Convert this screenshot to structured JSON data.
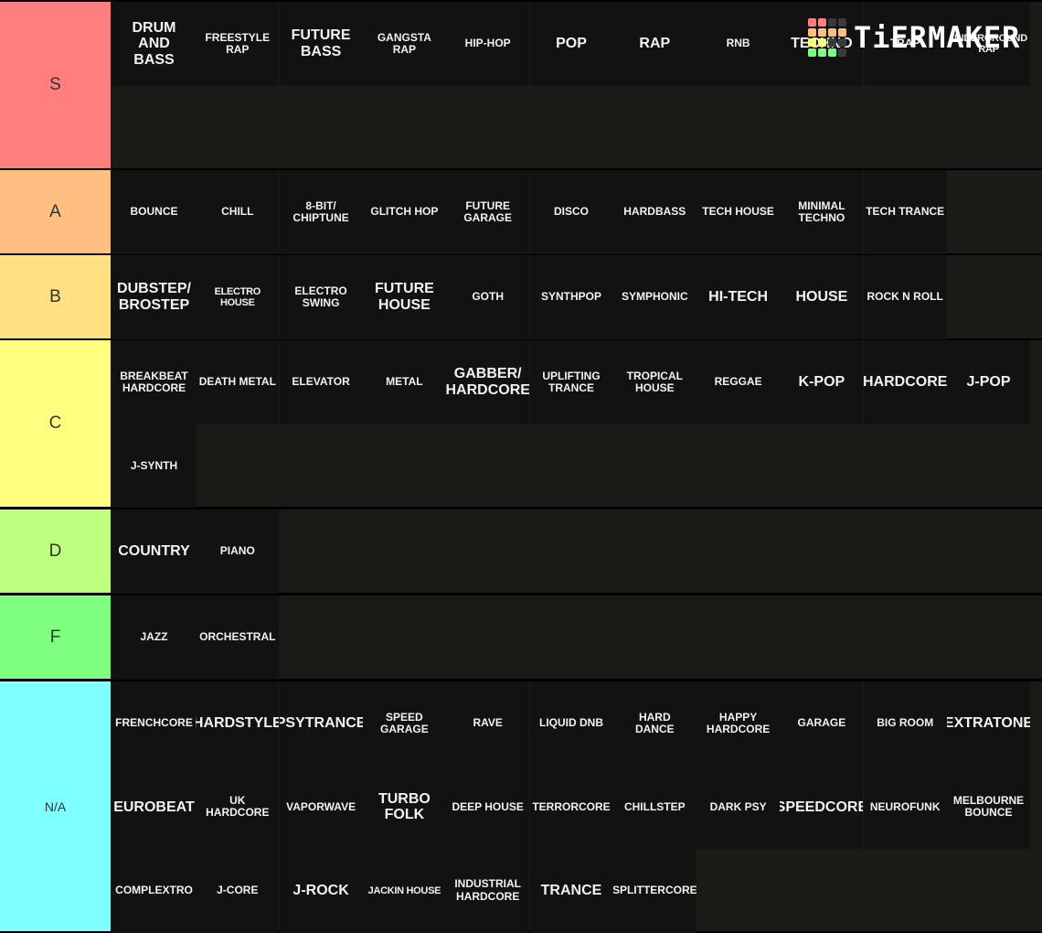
{
  "logo": {
    "text": "TiERMAKER",
    "grid_colors": [
      "#ff7f7f",
      "#ff7f7f",
      "#3a3a3a",
      "#3a3a3a",
      "#ffbf7f",
      "#ffbf7f",
      "#ffbf7f",
      "#ffbf7f",
      "#ffff7f",
      "#ffff7f",
      "#3a3a3a",
      "#3a3a3a",
      "#7fff7f",
      "#7fff7f",
      "#7fff7f",
      "#3a3a3a"
    ]
  },
  "tiers": [
    {
      "label": "S",
      "color": "#ff7f7f",
      "items": [
        {
          "text": "DRUM\nAND\nBASS",
          "size": "l"
        },
        {
          "text": "FREESTYLE\nRAP",
          "size": "s"
        },
        {
          "text": "FUTURE\nBASS",
          "size": "l"
        },
        {
          "text": "GANGSTA\nRAP",
          "size": "s"
        },
        {
          "text": "HIP-HOP",
          "size": "s"
        },
        {
          "text": "POP",
          "size": "l"
        },
        {
          "text": "RAP",
          "size": "l"
        },
        {
          "text": "RNB",
          "size": "s"
        },
        {
          "text": "TECHNO",
          "size": "l"
        },
        {
          "text": "TRAP",
          "size": "s"
        },
        {
          "text": "UNDERGROUND\nRAP",
          "size": "xs"
        }
      ]
    },
    {
      "label": "A",
      "color": "#ffbf7f",
      "items": [
        {
          "text": "BOUNCE",
          "size": "s"
        },
        {
          "text": "CHILL",
          "size": "s"
        },
        {
          "text": "8-BIT/\nCHIPTUNE",
          "size": "s"
        },
        {
          "text": "GLITCH HOP",
          "size": "s"
        },
        {
          "text": "FUTURE\nGARAGE",
          "size": "s"
        },
        {
          "text": "DISCO",
          "size": "s"
        },
        {
          "text": "HARDBASS",
          "size": "s"
        },
        {
          "text": "TECH HOUSE",
          "size": "s"
        },
        {
          "text": "MINIMAL\nTECHNO",
          "size": "s"
        },
        {
          "text": "TECH TRANCE",
          "size": "s"
        }
      ]
    },
    {
      "label": "B",
      "color": "#ffdf7f",
      "items": [
        {
          "text": "DUBSTEP/\nBROSTEP",
          "size": "l"
        },
        {
          "text": "ELECTRO HOUSE",
          "size": "xs"
        },
        {
          "text": "ELECTRO\nSWING",
          "size": "s"
        },
        {
          "text": "FUTURE\nHOUSE",
          "size": "l"
        },
        {
          "text": "GOTH",
          "size": "s"
        },
        {
          "text": "SYNTHPOP",
          "size": "s"
        },
        {
          "text": "SYMPHONIC",
          "size": "s"
        },
        {
          "text": "HI-TECH",
          "size": "l"
        },
        {
          "text": "HOUSE",
          "size": "l"
        },
        {
          "text": "ROCK N ROLL",
          "size": "s"
        }
      ]
    },
    {
      "label": "C",
      "color": "#ffff7f",
      "items": [
        {
          "text": "BREAKBEAT\nHARDCORE",
          "size": "s"
        },
        {
          "text": "DEATH METAL",
          "size": "s"
        },
        {
          "text": "ELEVATOR",
          "size": "s"
        },
        {
          "text": "METAL",
          "size": "s"
        },
        {
          "text": "GABBER/\nHARDCORE",
          "size": "l"
        },
        {
          "text": "UPLIFTING\nTRANCE",
          "size": "s"
        },
        {
          "text": "TROPICAL\nHOUSE",
          "size": "s"
        },
        {
          "text": "REGGAE",
          "size": "s"
        },
        {
          "text": "K-POP",
          "size": "l"
        },
        {
          "text": "HARDCORE",
          "size": "l"
        },
        {
          "text": "J-POP",
          "size": "l"
        },
        {
          "text": "J-SYNTH",
          "size": "s"
        }
      ]
    },
    {
      "label": "D",
      "color": "#bfff7f",
      "items": [
        {
          "text": "COUNTRY",
          "size": "l"
        },
        {
          "text": "PIANO",
          "size": "s"
        }
      ]
    },
    {
      "label": "F",
      "color": "#7fff7f",
      "items": [
        {
          "text": "JAZZ",
          "size": "s"
        },
        {
          "text": "ORCHESTRAL",
          "size": "s"
        }
      ]
    },
    {
      "label": "N/A",
      "color": "#7fffff",
      "items": [
        {
          "text": "FRENCHCORE",
          "size": "s"
        },
        {
          "text": "HARDSTYLE",
          "size": "l"
        },
        {
          "text": "PSYTRANCE",
          "size": "l"
        },
        {
          "text": "SPEED\nGARAGE",
          "size": "s"
        },
        {
          "text": "RAVE",
          "size": "s"
        },
        {
          "text": "LIQUID DNB",
          "size": "s"
        },
        {
          "text": "HARD\nDANCE",
          "size": "s"
        },
        {
          "text": "HAPPY\nHARDCORE",
          "size": "s"
        },
        {
          "text": "GARAGE",
          "size": "s"
        },
        {
          "text": "BIG ROOM",
          "size": "s"
        },
        {
          "text": "EXTRATONE",
          "size": "l"
        },
        {
          "text": "EUROBEAT",
          "size": "l"
        },
        {
          "text": "UK HARDCORE",
          "size": "s"
        },
        {
          "text": "VAPORWAVE",
          "size": "s"
        },
        {
          "text": "TURBO FOLK",
          "size": "l"
        },
        {
          "text": "DEEP HOUSE",
          "size": "s"
        },
        {
          "text": "TERRORCORE",
          "size": "s"
        },
        {
          "text": "CHILLSTEP",
          "size": "s"
        },
        {
          "text": "DARK PSY",
          "size": "s"
        },
        {
          "text": "SPEEDCORE",
          "size": "l"
        },
        {
          "text": "NEUROFUNK",
          "size": "s"
        },
        {
          "text": "MELBOURNE\nBOUNCE",
          "size": "s"
        },
        {
          "text": "COMPLEXTRO",
          "size": "s"
        },
        {
          "text": "J-CORE",
          "size": "s"
        },
        {
          "text": "J-ROCK",
          "size": "l"
        },
        {
          "text": "JACKIN HOUSE",
          "size": "xs"
        },
        {
          "text": "INDUSTRIAL\nHARDCORE",
          "size": "s"
        },
        {
          "text": "TRANCE",
          "size": "l"
        },
        {
          "text": "SPLITTERCORE",
          "size": "s"
        }
      ]
    }
  ]
}
